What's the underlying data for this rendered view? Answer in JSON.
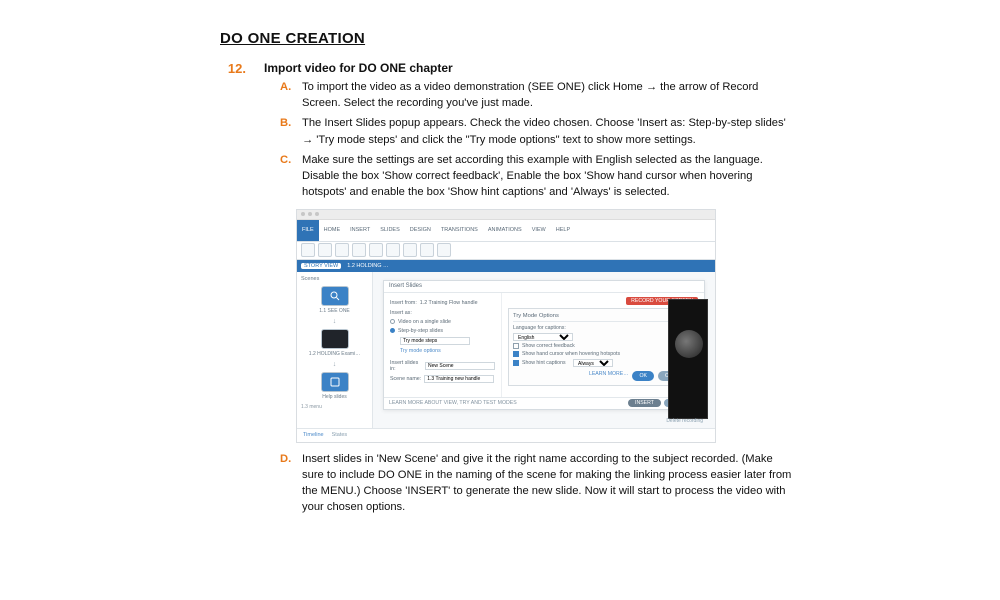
{
  "section_title": "DO ONE CREATION",
  "step": {
    "number": "12.",
    "heading": "Import video for DO ONE chapter",
    "items": [
      {
        "letter": "A.",
        "text": "To import the video as a video demonstration (SEE ONE) click Home → the arrow of Record Screen. Select the recording you've just made."
      },
      {
        "letter": "B.",
        "text": "The Insert Slides popup appears. Check the video chosen. Choose 'Insert as: Step-by-step slides' → 'Try mode steps' and click the \"Try mode options\" text to show more settings."
      },
      {
        "letter": "C.",
        "text": "Make sure the settings are set according this example with English selected as the language. Disable the box 'Show correct feedback', Enable the box 'Show hand cursor when hovering hotspots' and enable the box 'Show hint captions' and 'Always' is selected."
      },
      {
        "letter": "D.",
        "text": "Insert slides in 'New Scene' and give it the right name according to the subject recorded. (Make sure to include DO ONE in the naming of the scene for making the linking process easier later from the MENU.) Choose 'INSERT' to generate the new slide. Now it will start to process the video with your chosen options."
      }
    ]
  },
  "figure": {
    "ribbon": {
      "active_tab": "FILE",
      "tabs": [
        "HOME",
        "INSERT",
        "SLIDES",
        "DESIGN",
        "TRANSITIONS",
        "ANIMATIONS",
        "VIEW",
        "HELP"
      ]
    },
    "band": {
      "storyview": "STORY VIEW",
      "scene": "1.2 HOLDING …"
    },
    "scenes_panel": "Scenes",
    "thumbs": {
      "t1": "1.1 SEE ONE",
      "t2": "1.2 HOLDING Exami…",
      "t3": "Help slides",
      "t4": "1.3 menu"
    },
    "modal": {
      "title": "Insert Slides",
      "insert_from_label": "Insert from:",
      "insert_from_value": "1.2 Training Flow handle",
      "insert_as_label": "Insert as:",
      "opt_single": "Video on a single slide",
      "opt_steps": "Step-by-step slides",
      "try_mode_steps": "Try mode steps",
      "try_mode_options": "Try mode options",
      "insert_slides_in_label": "Insert slides in:",
      "insert_slides_in_value": "New Scene",
      "scene_name_label": "Scene name:",
      "scene_name_value": "1.3 Training new handle",
      "options": {
        "title": "Try Mode Options",
        "lang_label": "Language for captions:",
        "lang_value": "English",
        "show_correct": "Show correct feedback",
        "show_hand": "Show hand cursor when hovering hotspots",
        "show_hint": "Show hint captions",
        "always": "Always",
        "learn_more": "LEARN MORE…",
        "ok": "OK",
        "cancel": "CANCEL"
      },
      "footer_info": "LEARN MORE ABOUT VIEW, TRY AND TEST MODES",
      "record_btn": "RECORD YOUR SCREEN",
      "delete_recording": "Delete recording",
      "insert_btn": "INSERT",
      "cancel_btn": "CANCEL"
    },
    "footer": {
      "timeline": "Timeline",
      "states": "States"
    }
  }
}
